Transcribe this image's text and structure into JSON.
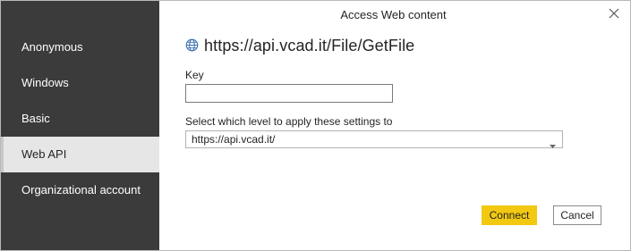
{
  "dialog": {
    "title": "Access Web content",
    "close_icon": "close-icon"
  },
  "sidebar": {
    "items": [
      {
        "label": "Anonymous",
        "selected": false
      },
      {
        "label": "Windows",
        "selected": false
      },
      {
        "label": "Basic",
        "selected": false
      },
      {
        "label": "Web API",
        "selected": true
      },
      {
        "label": "Organizational account",
        "selected": false
      }
    ]
  },
  "main": {
    "url_icon": "globe-icon",
    "url": "https://api.vcad.it/File/GetFile",
    "key": {
      "label": "Key",
      "value": ""
    },
    "level": {
      "label": "Select which level to apply these settings to",
      "selected": "https://api.vcad.it/"
    }
  },
  "footer": {
    "connect_label": "Connect",
    "cancel_label": "Cancel"
  },
  "colors": {
    "sidebar_bg": "#3b3b3b",
    "selected_item_bg": "#e6e6e6",
    "accent_button": "#f2c811",
    "globe_icon": "#3a6fb0"
  }
}
